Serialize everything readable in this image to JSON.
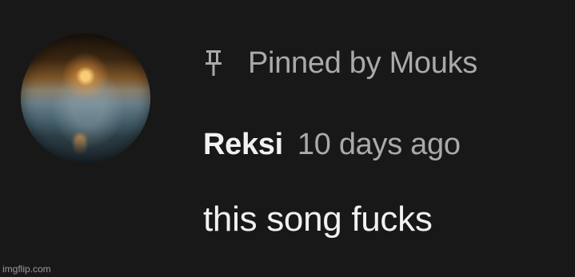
{
  "comment": {
    "pinned_label": "Pinned by Mouks",
    "author": "Reksi",
    "timestamp": "10 days ago",
    "text": "this song fucks",
    "icons": {
      "avatar": "avatar-sunset-image",
      "pin": "pin-icon"
    }
  },
  "watermark": {
    "text": "imgflip.com"
  },
  "colors": {
    "background": "#181818",
    "primary_text": "#f1f1f1",
    "secondary_text": "#aaaaaa"
  }
}
